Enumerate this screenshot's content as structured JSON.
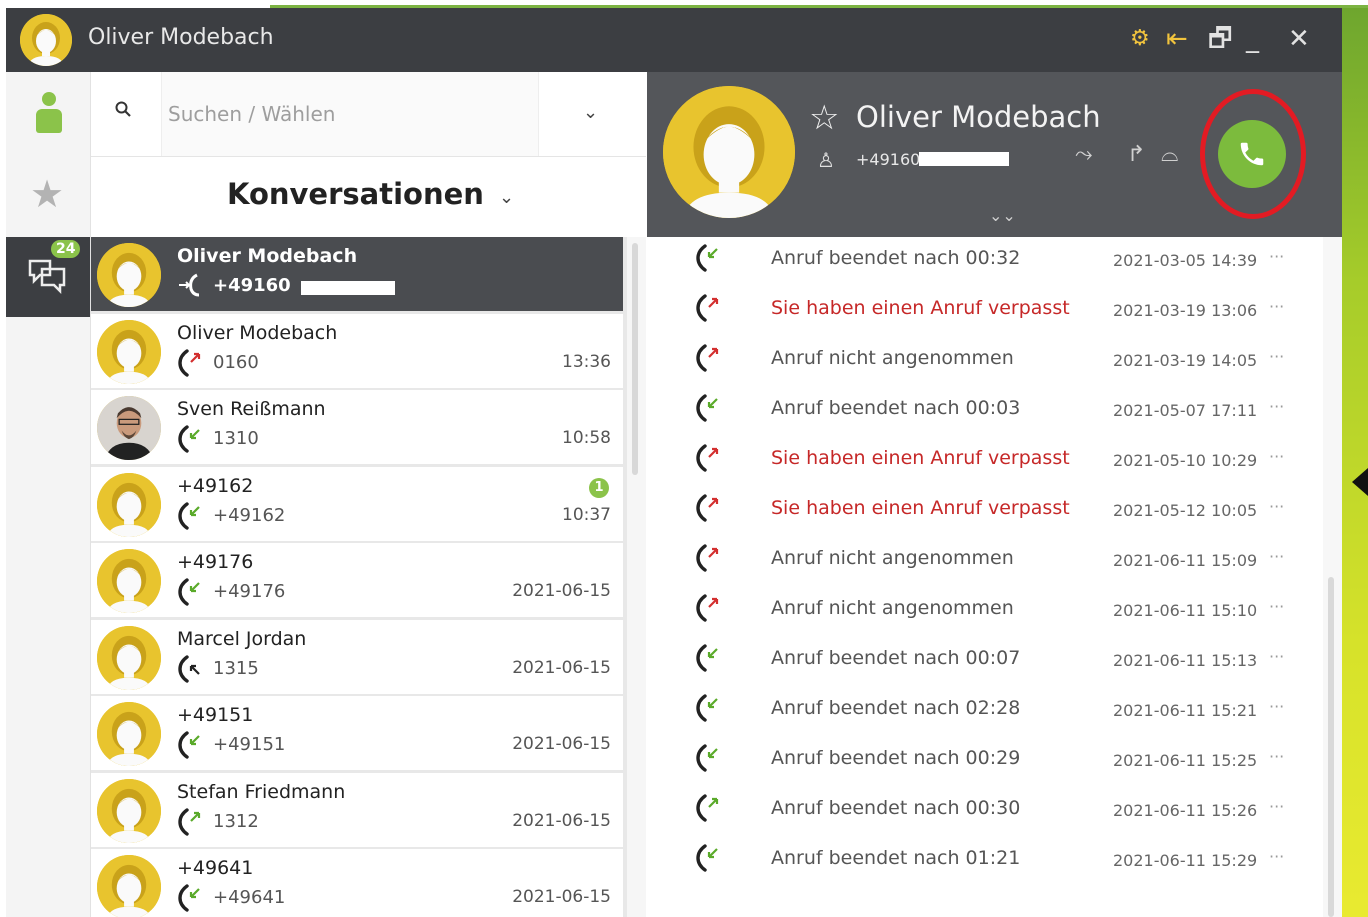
{
  "window": {
    "title": "Oliver Modebach",
    "controls": [
      "gear-user-icon",
      "pin-icon",
      "restore-icon",
      "minimize-icon",
      "close-icon"
    ]
  },
  "sidebar": {
    "conversations_badge": "24"
  },
  "search": {
    "placeholder": "Suchen / Wählen"
  },
  "conversations_header": "Konversationen",
  "conversations": [
    {
      "name": "Oliver Modebach",
      "number": "+49160",
      "time": "",
      "badge": "",
      "selected": true,
      "call": "outgoing"
    },
    {
      "name": "Oliver Modebach",
      "number": "0160",
      "time": "13:36",
      "badge": "",
      "selected": false,
      "call": "missed"
    },
    {
      "name": "Sven Reißmann",
      "number": "1310",
      "time": "10:58",
      "badge": "",
      "selected": false,
      "call": "answered",
      "photo": true
    },
    {
      "name": "+49162",
      "number": "+49162",
      "time": "10:37",
      "badge": "1",
      "selected": false,
      "call": "answered"
    },
    {
      "name": "+49176",
      "number": "+49176",
      "time": "2021-06-15",
      "badge": "",
      "selected": false,
      "call": "answered"
    },
    {
      "name": "Marcel Jordan",
      "number": "1315",
      "time": "2021-06-15",
      "badge": "",
      "selected": false,
      "call": "incoming"
    },
    {
      "name": "+49151",
      "number": "+49151",
      "time": "2021-06-15",
      "badge": "",
      "selected": false,
      "call": "answered"
    },
    {
      "name": "Stefan Friedmann",
      "number": "1312",
      "time": "2021-06-15",
      "badge": "",
      "selected": false,
      "call": "outgoing-green"
    },
    {
      "name": "+49641",
      "number": "+49641",
      "time": "2021-06-15",
      "badge": "",
      "selected": false,
      "call": "answered"
    }
  ],
  "contact": {
    "name": "Oliver Modebach",
    "number": "+49160"
  },
  "history": [
    {
      "text": "Anruf beendet nach 00:32",
      "date": "2021-03-05 14:39",
      "type": "answered"
    },
    {
      "text": "Sie haben einen Anruf verpasst",
      "date": "2021-03-19 13:06",
      "type": "missed"
    },
    {
      "text": "Anruf nicht angenommen",
      "date": "2021-03-19 14:05",
      "type": "outgoing-missed"
    },
    {
      "text": "Anruf beendet nach 00:03",
      "date": "2021-05-07 17:11",
      "type": "answered"
    },
    {
      "text": "Sie haben einen Anruf verpasst",
      "date": "2021-05-10 10:29",
      "type": "missed"
    },
    {
      "text": "Sie haben einen Anruf verpasst",
      "date": "2021-05-12 10:05",
      "type": "missed"
    },
    {
      "text": "Anruf nicht angenommen",
      "date": "2021-06-11 15:09",
      "type": "outgoing-missed"
    },
    {
      "text": "Anruf nicht angenommen",
      "date": "2021-06-11 15:10",
      "type": "outgoing-missed"
    },
    {
      "text": "Anruf beendet nach 00:07",
      "date": "2021-06-11 15:13",
      "type": "answered"
    },
    {
      "text": "Anruf beendet nach 02:28",
      "date": "2021-06-11 15:21",
      "type": "answered"
    },
    {
      "text": "Anruf beendet nach 00:29",
      "date": "2021-06-11 15:25",
      "type": "answered"
    },
    {
      "text": "Anruf beendet nach 00:30",
      "date": "2021-06-11 15:26",
      "type": "outgoing"
    },
    {
      "text": "Anruf beendet nach 01:21",
      "date": "2021-06-11 15:29",
      "type": "answered"
    }
  ],
  "history_more": "···",
  "colors": {
    "accent_green": "#7cbb3d",
    "missed_red": "#c62828",
    "titlebar": "#3c3e42",
    "contact_header": "#54565a",
    "avatar_yellow": "#e8c42e",
    "highlight_ring": "#e31b23"
  }
}
